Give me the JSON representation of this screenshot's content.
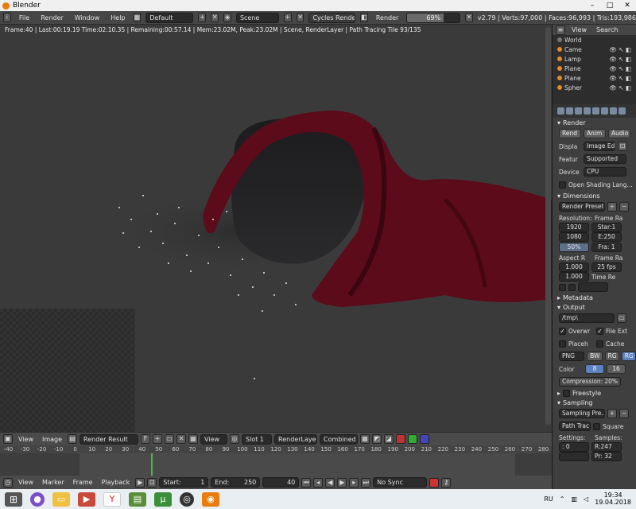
{
  "window": {
    "title": "Blender",
    "controls": [
      "–",
      "□",
      "✕"
    ]
  },
  "menubar": {
    "menus": [
      "File",
      "Render",
      "Window",
      "Help"
    ],
    "screen_layout": "Default",
    "scene": "Scene",
    "engine": "Cycles Render",
    "render_label": "Render",
    "render_progress_label": "69%",
    "render_progress_value": 0.69,
    "stats": "v2.79 | Verts:97,000 | Faces:96,993 | Tris:193,986"
  },
  "viewport": {
    "render_stats": "Frame:40 | Last:00:19.19 Time:02:10.35 | Remaining:00:57.14 | Mem:23.02M, Peak:23.02M | Scene, RenderLayer | Path Tracing Tile 93/135"
  },
  "image_editor_header": {
    "menus": [
      "View",
      "Image"
    ],
    "image": "Render Result",
    "fake_user": "F",
    "view_label": "View",
    "slot": "Slot 1",
    "layer": "RenderLayer",
    "pass": "Combined"
  },
  "timeline": {
    "ruler": [
      "-40",
      "-30",
      "-20",
      "-10",
      "0",
      "10",
      "20",
      "30",
      "40",
      "50",
      "60",
      "70",
      "80",
      "90",
      "100",
      "110",
      "120",
      "130",
      "140",
      "150",
      "160",
      "170",
      "180",
      "190",
      "200",
      "210",
      "220",
      "230",
      "240",
      "250",
      "260",
      "270",
      "280"
    ],
    "menus": [
      "View",
      "Marker",
      "Frame",
      "Playback"
    ],
    "start_label": "Start:",
    "start_value": "1",
    "end_label": "End:",
    "end_value": "250",
    "current_frame": "40",
    "sync": "No Sync"
  },
  "outliner": {
    "header": [
      "View",
      "Search"
    ],
    "items": [
      "World",
      "Came",
      "Lamp",
      "Plane",
      "Plane",
      "Spher"
    ]
  },
  "properties": {
    "render_section": "Render",
    "render_buttons": [
      "Rend",
      "Anim",
      "Audio"
    ],
    "display_label": "Displa",
    "display_value": "Image Ed",
    "feature_label": "Featur",
    "feature_value": "Supported",
    "device_label": "Device",
    "device_value": "CPU",
    "open_shading": "Open Shading Lang...",
    "dimensions_section": "Dimensions",
    "render_presets": "Render Presets",
    "resolution_label": "Resolution:",
    "frame_range_label": "Frame Ra",
    "res_x": "1920",
    "res_y": "1080",
    "res_pct": "50%",
    "frame_start": "Star:1",
    "frame_end": "E:250",
    "frame_step": "Fra: 1",
    "aspect_label": "Aspect R",
    "frame_rate_label": "Frame Ra",
    "aspect_x": "1.000",
    "aspect_y": "1.000",
    "fps": "25 fps",
    "time_remap": "Time Re",
    "metadata_section": "Metadata",
    "output_section": "Output",
    "output_path": "/tmp\\",
    "overwrite": "Overwr",
    "file_ext": "File Ext",
    "placeholders": "Placeh",
    "cache": "Cache",
    "format": "PNG",
    "bw": "BW",
    "rgb": "RG",
    "rgba": "RG",
    "color_label": "Color",
    "color_depth_8": "8",
    "color_depth_16": "16",
    "compression": "Compression:",
    "compression_value": "20%",
    "freestyle_section": "Freestyle",
    "sampling_section": "Sampling",
    "sampling_presets": "Sampling Pre...",
    "path_tracing": "Path Trac",
    "square": "Square",
    "settings_label": "Settings:",
    "samples_label": "Samples:",
    "seed": ": 0",
    "render_samples": "R:247",
    "preview_samples": "Pr: 32"
  },
  "taskbar": {
    "lang": "RU",
    "time": "19:34",
    "date": "19.04.2018"
  }
}
